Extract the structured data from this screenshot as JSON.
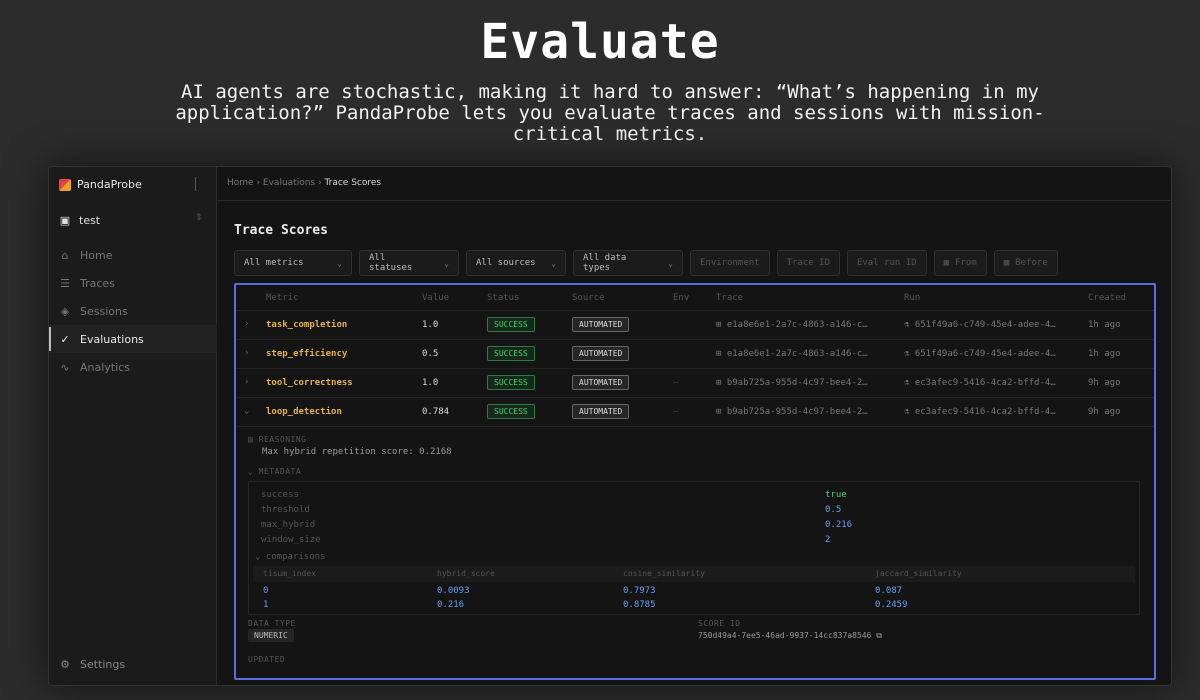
{
  "hero": {
    "title": "Evaluate",
    "subtitle": "AI agents are stochastic, making it hard to answer: “What’s happening in my application?” PandaProbe lets you evaluate traces and sessions with mission-critical metrics."
  },
  "sidebar": {
    "brand": "PandaProbe",
    "project": "test",
    "items": [
      {
        "label": "Home",
        "icon": "home-icon",
        "active": false
      },
      {
        "label": "Traces",
        "icon": "list-icon",
        "active": false
      },
      {
        "label": "Sessions",
        "icon": "layers-icon",
        "active": false
      },
      {
        "label": "Evaluations",
        "icon": "check-circle-icon",
        "active": true
      },
      {
        "label": "Analytics",
        "icon": "chart-icon",
        "active": false
      }
    ],
    "settings": "Settings"
  },
  "breadcrumb": {
    "home": "Home",
    "evaluations": "Evaluations",
    "current": "Trace Scores"
  },
  "page_title": "Trace Scores",
  "filters": {
    "metrics": "All metrics",
    "statuses": "All statuses",
    "sources": "All sources",
    "data_types": "All data types",
    "environment": "Environment",
    "trace_id": "Trace ID",
    "eval_run_id": "Eval run ID",
    "from": "From",
    "before": "Before"
  },
  "table": {
    "columns": {
      "metric": "Metric",
      "value": "Value",
      "status": "Status",
      "source": "Source",
      "env": "Env",
      "trace": "Trace",
      "run": "Run",
      "created": "Created"
    },
    "rows": [
      {
        "metric": "task_completion",
        "value": "1.0",
        "status": "SUCCESS",
        "source": "AUTOMATED",
        "env": "",
        "trace": "e1a8e6e1-2a7c-4863-a146-c…",
        "run": "651f49a6-c749-45e4-adee-4…",
        "created": "1h ago"
      },
      {
        "metric": "step_efficiency",
        "value": "0.5",
        "status": "SUCCESS",
        "source": "AUTOMATED",
        "env": "",
        "trace": "e1a8e6e1-2a7c-4863-a146-c…",
        "run": "651f49a6-c749-45e4-adee-4…",
        "created": "1h ago"
      },
      {
        "metric": "tool_correctness",
        "value": "1.0",
        "status": "SUCCESS",
        "source": "AUTOMATED",
        "env": "—",
        "trace": "b9ab725a-955d-4c97-bee4-2…",
        "run": "ec3afec9-5416-4ca2-bffd-4…",
        "created": "9h ago"
      },
      {
        "metric": "loop_detection",
        "value": "0.784",
        "status": "SUCCESS",
        "source": "AUTOMATED",
        "env": "—",
        "trace": "b9ab725a-955d-4c97-bee4-2…",
        "run": "ec3afec9-5416-4ca2-bffd-4…",
        "created": "9h ago"
      }
    ]
  },
  "details": {
    "reasoning_label": "REASONING",
    "reasoning_text": "Max hybrid repetition score: 0.2168",
    "metadata_label": "METADATA",
    "metadata": [
      {
        "key": "success",
        "value": "true"
      },
      {
        "key": "threshold",
        "value": "0.5"
      },
      {
        "key": "max_hybrid",
        "value": "0.216"
      },
      {
        "key": "window_size",
        "value": "2"
      }
    ],
    "comparisons_label": "comparisons",
    "comparison_columns": [
      "tisum_index",
      "hybrid_score",
      "cosine_similarity",
      "jaccard_similarity"
    ],
    "comparison_rows": [
      [
        "0",
        "0.0093",
        "0.7973",
        "0.087"
      ],
      [
        "1",
        "0.216",
        "0.8785",
        "0.2459"
      ]
    ],
    "data_type_label": "DATA TYPE",
    "data_type": "NUMERIC",
    "score_id_label": "SCORE ID",
    "score_id": "750d49a4-7ee5-46ad-9937-14cc837a8546",
    "updated_label": "UPDATED"
  }
}
